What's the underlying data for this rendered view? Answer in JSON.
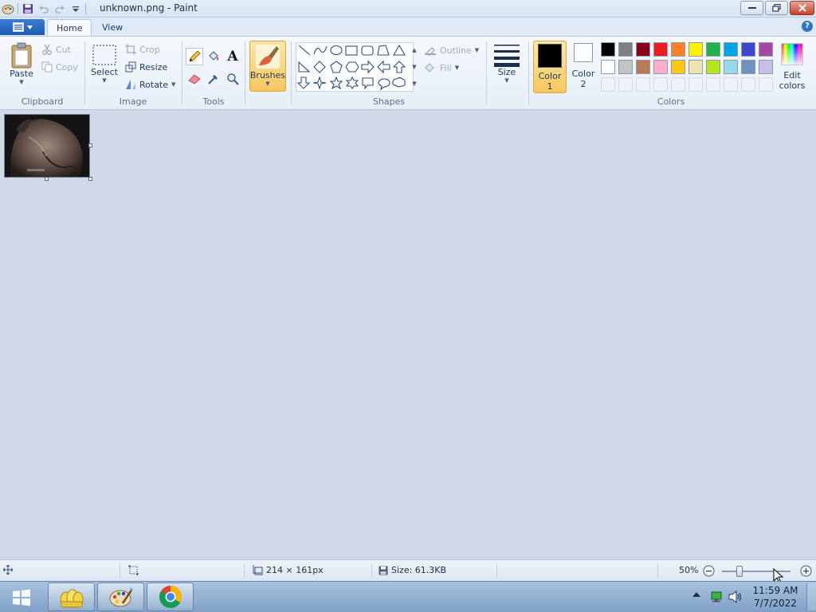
{
  "window": {
    "title": "unknown.png - Paint"
  },
  "tabs": [
    {
      "label": "Home"
    },
    {
      "label": "View"
    }
  ],
  "clipboard": {
    "paste": "Paste",
    "cut": "Cut",
    "copy": "Copy",
    "label": "Clipboard"
  },
  "image": {
    "select": "Select",
    "crop": "Crop",
    "resize": "Resize",
    "rotate": "Rotate",
    "label": "Image"
  },
  "tools": {
    "label": "Tools"
  },
  "brushes": {
    "label": "Brushes"
  },
  "shapes": {
    "outline": "Outline",
    "fill": "Fill",
    "label": "Shapes"
  },
  "size": {
    "label": "Size"
  },
  "color1": {
    "line1": "Color",
    "line2": "1"
  },
  "color2": {
    "line1": "Color",
    "line2": "2"
  },
  "colors": {
    "label": "Colors",
    "edit_line1": "Edit",
    "edit_line2": "colors",
    "row1": [
      "#000000",
      "#7f7f7f",
      "#880015",
      "#ed1c24",
      "#ff7f27",
      "#fff200",
      "#22b14c",
      "#00a2e8",
      "#3f48cc",
      "#a349a4"
    ],
    "row2": [
      "#ffffff",
      "#c3c3c3",
      "#b97a57",
      "#ffaec9",
      "#ffc90e",
      "#efe4b0",
      "#b5e61d",
      "#99d9ea",
      "#7092be",
      "#c8bfe7"
    ]
  },
  "status": {
    "dimensions": "214 × 161px",
    "size": "Size: 61.3KB",
    "zoom": "50%",
    "zoom_level": 0.25
  },
  "clock": {
    "time": "11:59 AM",
    "date": "7/7/2022"
  }
}
